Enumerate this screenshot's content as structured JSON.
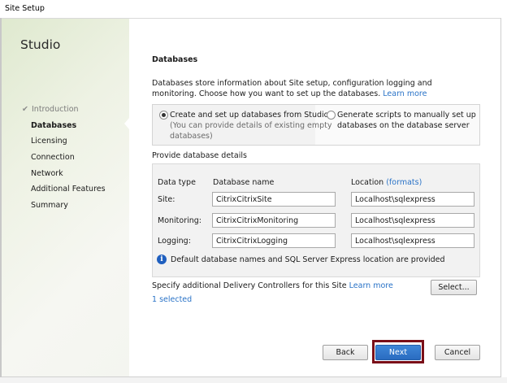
{
  "window": {
    "title": "Site Setup"
  },
  "sidebar": {
    "title": "Studio",
    "steps": [
      {
        "label": "Introduction",
        "state": "done"
      },
      {
        "label": "Databases",
        "state": "current"
      },
      {
        "label": "Licensing",
        "state": "pending"
      },
      {
        "label": "Connection",
        "state": "pending"
      },
      {
        "label": "Network",
        "state": "pending"
      },
      {
        "label": "Additional Features",
        "state": "pending"
      },
      {
        "label": "Summary",
        "state": "pending"
      }
    ]
  },
  "main": {
    "heading": "Databases",
    "description": "Databases store information about Site setup, configuration logging and monitoring. Choose how you want to set up the databases.",
    "learn_more": "Learn more",
    "options": [
      {
        "line1": "Create and set up databases from Studio",
        "line2": "(You can provide details of existing empty",
        "line3": "databases)",
        "selected": true
      },
      {
        "line1": "Generate scripts to manually set up",
        "line2": "databases on the database server",
        "selected": false
      }
    ],
    "provide_label": "Provide database details",
    "table": {
      "col_type": "Data type",
      "col_name": "Database name",
      "col_location": "Location",
      "formats_link": "(formats)",
      "rows": [
        {
          "type": "Site:",
          "name": "CitrixCitrixSite",
          "location": "Localhost\\sqlexpress"
        },
        {
          "type": "Monitoring:",
          "name": "CitrixCitrixMonitoring",
          "location": "Localhost\\sqlexpress"
        },
        {
          "type": "Logging:",
          "name": "CitrixCitrixLogging",
          "location": "Localhost\\sqlexpress"
        }
      ]
    },
    "info_text": "Default database names and SQL Server Express location are provided",
    "controllers_text": "Specify additional Delivery Controllers for this Site",
    "controllers_learn_more": "Learn more",
    "selected_count": "1 selected",
    "select_button": "Select..."
  },
  "buttons": {
    "back": "Back",
    "next": "Next",
    "cancel": "Cancel"
  },
  "colors": {
    "accent": "#2a6cc0",
    "link": "#2a73c7",
    "highlight": "#7a0f18"
  }
}
